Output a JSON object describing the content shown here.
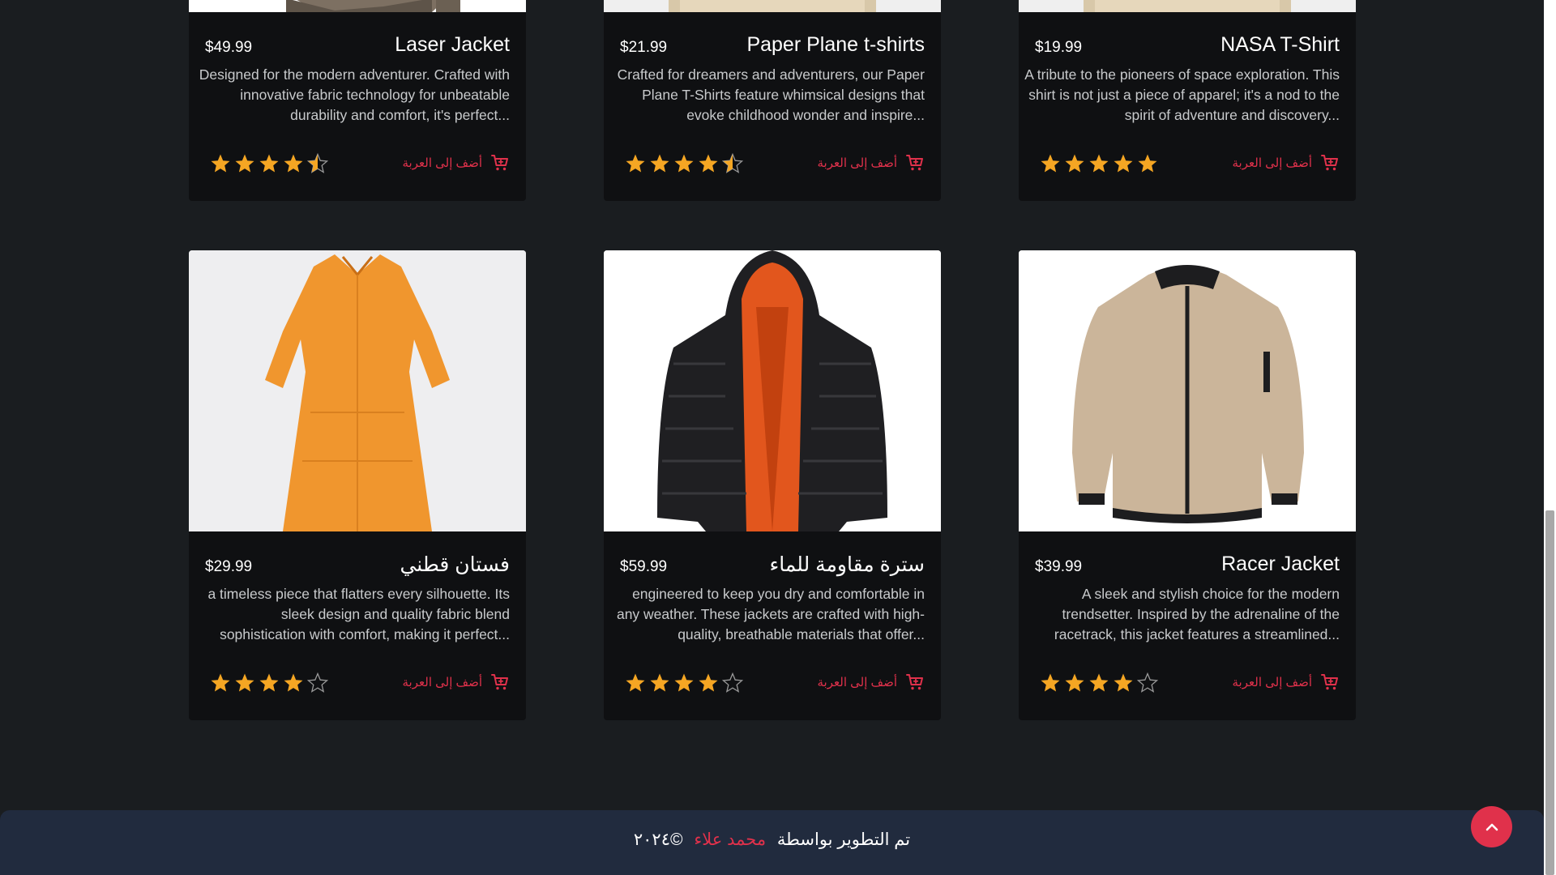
{
  "products": [
    {
      "price": "$49.99",
      "title": "Laser Jacket",
      "description": "Designed for the modern adventurer. Crafted with innovative fabric technology for unbeatable durability and comfort, it's perfect...",
      "rating": 4.5,
      "add_to_cart": "أضف إلى العربة",
      "image": "khaki-jacket"
    },
    {
      "price": "$21.99",
      "title": "Paper Plane t-shirts",
      "description": "Crafted for dreamers and adventurers, our Paper Plane T-Shirts feature whimsical designs that evoke childhood wonder and inspire...",
      "rating": 4.5,
      "add_to_cart": "أضف إلى العربة",
      "image": "beige-tshirt"
    },
    {
      "price": "$19.99",
      "title": "NASA T-Shirt",
      "description": "A tribute to the pioneers of space exploration. This shirt is not just a piece of apparel; it's a nod to the spirit of adventure and discovery...",
      "rating": 5,
      "add_to_cart": "أضف إلى العربة",
      "image": "beige-tshirt"
    },
    {
      "price": "$29.99",
      "title": "فستان قطني",
      "description": "a timeless piece that flatters every silhouette. Its sleek design and quality fabric blend sophistication with comfort, making it perfect...",
      "rating": 4,
      "add_to_cart": "أضف إلى العربة",
      "image": "orange-dress"
    },
    {
      "price": "$59.99",
      "title": "سترة مقاومة للماء",
      "description": "engineered to keep you dry and comfortable in any weather. These jackets are crafted with high-quality, breathable materials that offer...",
      "rating": 4,
      "add_to_cart": "أضف إلى العربة",
      "image": "puffer-jacket"
    },
    {
      "price": "$39.99",
      "title": "Racer Jacket",
      "description": "A sleek and stylish choice for the modern trendsetter. Inspired by the adrenaline of the racetrack, this jacket features a streamlined...",
      "rating": 4,
      "add_to_cart": "أضف إلى العربة",
      "image": "bomber-jacket"
    }
  ],
  "footer": {
    "prefix": "تم التطوير بواسطة",
    "author": "محمد علاء",
    "copyright": "©٢٠٢٤"
  },
  "colors": {
    "accent": "#e0314b",
    "star": "#f5a623",
    "background": "#1a1d20",
    "card": "#0f1012",
    "footer": "#212b3e"
  }
}
